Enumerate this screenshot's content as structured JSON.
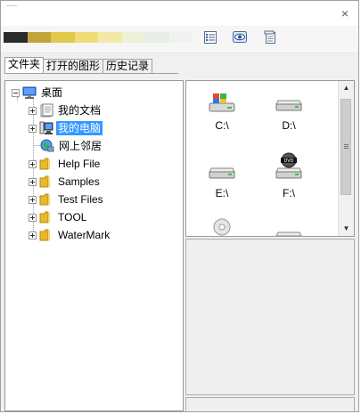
{
  "window": {
    "close_symbol": "×"
  },
  "toolbar": {
    "color_strip": [
      "#2b2b2b",
      "#c4a43a",
      "#e0c84c",
      "#f0dc78",
      "#f4e8a8",
      "#eef0d8",
      "#e6ece6",
      "#f0f2f0"
    ],
    "buttons": [
      {
        "icon": "list-view-icon"
      },
      {
        "icon": "eye-preview-icon"
      },
      {
        "icon": "document-icon"
      }
    ]
  },
  "tabs": [
    {
      "label": "文件夹"
    },
    {
      "label": "打开的图形"
    },
    {
      "label": "历史记录"
    }
  ],
  "tree": {
    "root": {
      "label": "桌面",
      "icon": "desktop-icon"
    },
    "items": [
      {
        "label": "我的文档",
        "icon": "my-documents-icon"
      },
      {
        "label": "我的电脑",
        "icon": "my-computer-icon"
      },
      {
        "label": "网上邻居",
        "icon": "network-icon"
      },
      {
        "label": "Help File",
        "icon": "folder-icon"
      },
      {
        "label": "Samples",
        "icon": "folder-icon"
      },
      {
        "label": "Test Files",
        "icon": "folder-icon"
      },
      {
        "label": "TOOL",
        "icon": "folder-icon"
      },
      {
        "label": "WaterMark",
        "icon": "folder-icon"
      }
    ]
  },
  "drives": [
    {
      "label": "C:\\",
      "icon": "system-drive-icon"
    },
    {
      "label": "D:\\",
      "icon": "hard-drive-icon"
    },
    {
      "label": "E:\\",
      "icon": "hard-drive-icon"
    },
    {
      "label": "F:\\",
      "icon": "dvd-drive-icon"
    }
  ],
  "colors": {
    "selection": "#3399ff",
    "folder": "#f2c94c"
  }
}
